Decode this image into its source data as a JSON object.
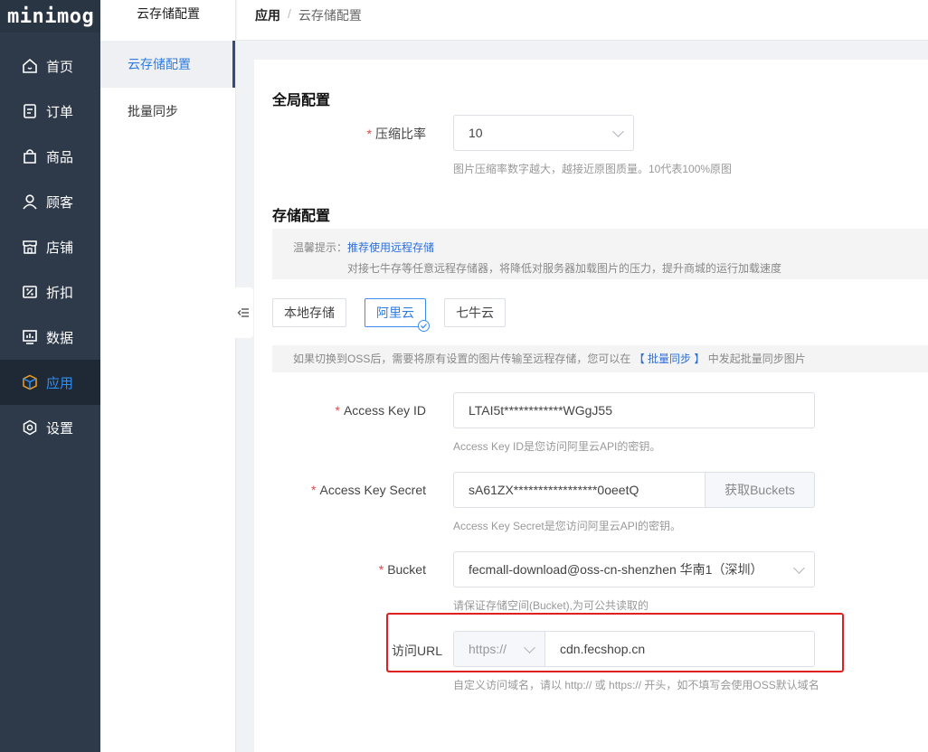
{
  "app": {
    "logo": "minimog"
  },
  "sidebar": {
    "items": [
      {
        "label": "首页",
        "icon": "home-icon"
      },
      {
        "label": "订单",
        "icon": "order-icon"
      },
      {
        "label": "商品",
        "icon": "bag-icon"
      },
      {
        "label": "顾客",
        "icon": "user-icon"
      },
      {
        "label": "店铺",
        "icon": "store-icon"
      },
      {
        "label": "折扣",
        "icon": "discount-icon"
      },
      {
        "label": "数据",
        "icon": "chart-icon"
      },
      {
        "label": "应用",
        "icon": "cube-icon"
      },
      {
        "label": "设置",
        "icon": "gear-icon"
      }
    ],
    "active_index": 7
  },
  "submenu": {
    "title": "云存储配置",
    "items": [
      {
        "label": "云存储配置"
      },
      {
        "label": "批量同步"
      }
    ],
    "active_index": 0
  },
  "breadcrumb": {
    "parent": "应用",
    "separator": "/",
    "current": "云存储配置"
  },
  "global_config": {
    "title": "全局配置",
    "compression": {
      "label": "压缩比率",
      "value": "10",
      "hint": "图片压缩率数字越大，越接近原图质量。10代表100%原图"
    }
  },
  "storage_config": {
    "title": "存储配置",
    "tip": {
      "prefix": "温馨提示：",
      "link": "推荐使用远程存储",
      "text": "对接七牛存等任意远程存储器，将降低对服务器加载图片的压力，提升商城的运行加载速度"
    },
    "tabs": [
      {
        "label": "本地存储"
      },
      {
        "label": "阿里云"
      },
      {
        "label": "七牛云"
      }
    ],
    "active_tab": 1,
    "notice": {
      "before": "如果切换到OSS后，需要将原有设置的图片传输至远程存储，您可以在",
      "link": "【 批量同步 】",
      "after": "中发起批量同步图片"
    }
  },
  "oss_form": {
    "access_key_id": {
      "label": "Access Key ID",
      "value": "LTAI5t************WGgJ55",
      "hint": "Access Key ID是您访问阿里云API的密钥。"
    },
    "access_key_secret": {
      "label": "Access Key Secret",
      "value": "sA61ZX*****************0oeetQ",
      "button": "获取Buckets",
      "hint": "Access Key Secret是您访问阿里云API的密钥。"
    },
    "bucket": {
      "label": "Bucket",
      "value": "fecmall-download@oss-cn-shenzhen 华南1（深圳）",
      "hint": "请保证存储空间(Bucket),为可公共读取的"
    },
    "access_url": {
      "label": "访问URL",
      "protocol": "https://",
      "value": "cdn.fecshop.cn",
      "hint": "自定义访问域名，请以 http:// 或 https:// 开头，如不填写会使用OSS默认域名"
    }
  },
  "colors": {
    "sidebar_bg": "#2e3a4a",
    "accent": "#2f7de1",
    "required": "#e04848",
    "highlight_box": "#e02020"
  }
}
